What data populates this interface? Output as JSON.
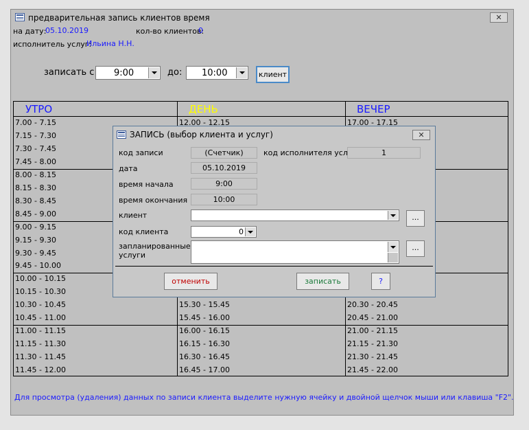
{
  "window": {
    "title": "предварительная запись клиентов время",
    "close_glyph": "✕"
  },
  "header": {
    "date_label": "на дату:",
    "date_value": "05.10.2019",
    "count_label": "кол-во клиентов:",
    "count_value": "0",
    "performer_label": "исполнитель услуг:",
    "performer_value": "Ильина Н.Н."
  },
  "time_filter": {
    "from_label": "записать с:",
    "from_value": "9:00",
    "to_label": "до:",
    "to_value": "10:00",
    "client_button": "клиент"
  },
  "schedule": {
    "columns": [
      {
        "label": "УТРО",
        "color": "#1a1aff"
      },
      {
        "label": "ДЕНЬ",
        "color": "#ffff00"
      },
      {
        "label": "ВЕЧЕР",
        "color": "#1a1aff"
      }
    ],
    "morning": [
      "7.00 - 7.15",
      "7.15 - 7.30",
      "7.30 - 7.45",
      "7.45 - 8.00",
      "8.00 - 8.15",
      "8.15 - 8.30",
      "8.30 - 8.45",
      "8.45 - 9.00",
      "9.00 - 9.15",
      "9.15 - 9.30",
      "9.30 - 9.45",
      "9.45 - 10.00",
      "10.00 - 10.15",
      "10.15 - 10.30",
      "10.30 - 10.45",
      "10.45 - 11.00",
      "11.00 - 11.15",
      "11.15 - 11.30",
      "11.30 - 11.45",
      "11.45 - 12.00"
    ],
    "day": [
      "12.00 - 12.15",
      "15.30 - 15.45",
      "15.45 - 16.00",
      "16.00 - 16.15",
      "16.15 - 16.30",
      "16.30 - 16.45",
      "16.45 - 17.00"
    ],
    "evening": [
      "17.00 - 17.15",
      "20.30 - 20.45",
      "20.45 - 21.00",
      "21.00 - 21.15",
      "21.15 - 21.30",
      "21.30 - 21.45",
      "21.45 - 22.00"
    ]
  },
  "footer_note": "Для просмотра (удаления) данных по записи клиента выделите нужную ячейку и двойной щелчок мыши или клавиша \"F2\".",
  "dialog": {
    "title": "ЗАПИСЬ (выбор клиента и услуг)",
    "close_glyph": "✕",
    "record_code_label": "код записи",
    "record_code_value": "(Счетчик)",
    "performer_code_label": "код исполнителя услуг",
    "performer_code_value": "1",
    "date_label": "дата",
    "date_value": "05.10.2019",
    "start_label": "время начала",
    "start_value": "9:00",
    "end_label": "время окончания",
    "end_value": "10:00",
    "client_label": "клиент",
    "client_value": "",
    "ellipsis": "...",
    "client_code_label": "код клиента",
    "client_code_value": "0",
    "services_label_1": "запланированные",
    "services_label_2": "услуги",
    "cancel_button": "отменить",
    "save_button": "записать",
    "help_button": "?"
  }
}
